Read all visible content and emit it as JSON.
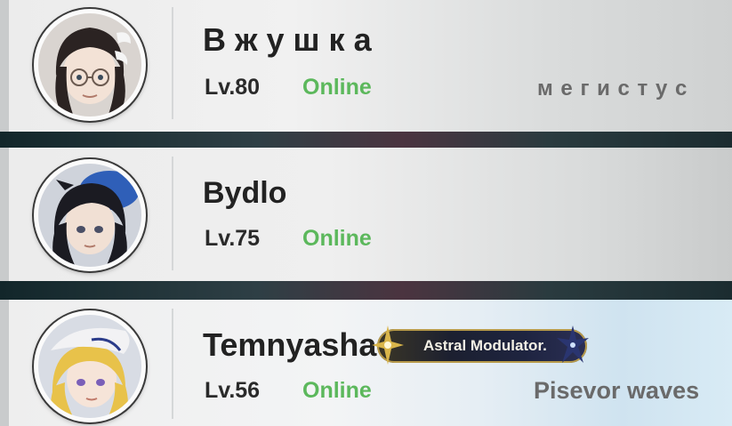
{
  "friends": [
    {
      "name": "В ж у ш к а",
      "level": "Lv.80",
      "status": "Online",
      "signature": "м е г и с т у с"
    },
    {
      "name": "Bydlo",
      "level": "Lv.75",
      "status": "Online",
      "signature": ""
    },
    {
      "name": "Temnyasha",
      "level": "Lv.56",
      "status": "Online",
      "badge": "Astral Modulator.",
      "signature": "Pisevor waves"
    }
  ],
  "colors": {
    "online": "#5cb85c",
    "name": "#222222",
    "signature": "#6a6a6a",
    "badge_bg": "#1e2440",
    "badge_border": "#b79a4a"
  }
}
